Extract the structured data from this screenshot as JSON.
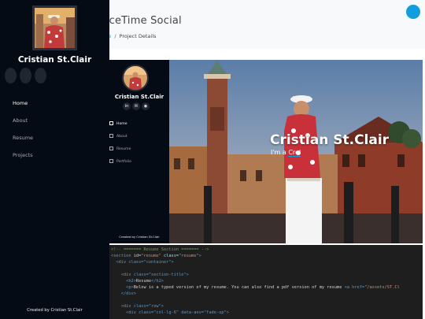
{
  "header": {
    "site_title": "paceTime Social",
    "breadcrumb_home": "me",
    "breadcrumb_sep": "/",
    "breadcrumb_current": "Project Details"
  },
  "sidebar": {
    "name": "Cristian St.Clair",
    "nav": [
      "Home",
      "About",
      "Resume",
      "Projects"
    ],
    "footer": "Created by Cristian St.Clair"
  },
  "preview": {
    "name": "Cristian St.Clair",
    "social": [
      "in",
      "✉",
      "◉"
    ],
    "nav": [
      "Home",
      "About",
      "Resume",
      "Portfolio"
    ],
    "footer": "Created by Cristian St.Clair",
    "hero_title": "Cristian St.Clair",
    "hero_sub_prefix": "I'm a ",
    "hero_sub_typed": "Crel"
  },
  "code": {
    "line1": "<!-- ======= Resume Section ======= -->",
    "line2_tag": "<section ",
    "line2_a1": "id=",
    "line2_v1": "\"resume\"",
    "line2_a2": " class=",
    "line2_v2": "\"resume\"",
    "line2_end": ">",
    "line3": "  <div class=\"container\">",
    "line5": "    <div class=\"section-title\">",
    "line6_open": "      <h2>",
    "line6_text": "Resume",
    "line6_close": "</h2>",
    "line7_open": "      <p>",
    "line7_text": "Below is a typed version of my resume. You can also find a pdf version of my resume ",
    "line7_link": "<a href=",
    "line7_href": "\"/assets/ST.Cl",
    "line8": "    </div>",
    "line10": "    <div class=\"row\">",
    "line11": "      <div class=\"col-lg-6\" data-aos=\"fade-up\">"
  },
  "colors": {
    "accent": "#149ddd",
    "sidebar_bg": "#040b14",
    "code_bg": "#1e1e1e"
  }
}
